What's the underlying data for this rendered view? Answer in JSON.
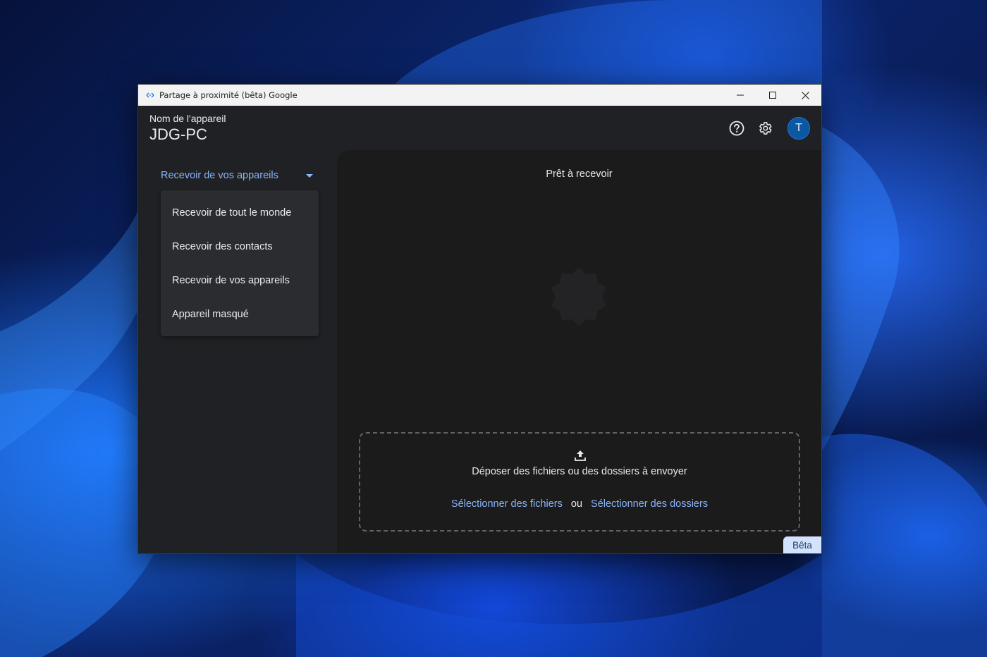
{
  "window": {
    "title": "Partage à proximité (bêta) Google",
    "minimize_glyph": "—",
    "maximize_glyph": "☐",
    "close_glyph": "✕"
  },
  "header": {
    "device_label": "Nom de l'appareil",
    "device_name": "JDG-PC",
    "help_icon": "help-circle-icon",
    "settings_icon": "gear-icon",
    "avatar_initial": "T"
  },
  "sidebar": {
    "selected_visibility": "Recevoir de vos appareils",
    "menu_items": [
      {
        "label": "Recevoir de tout le monde"
      },
      {
        "label": "Recevoir des contacts"
      },
      {
        "label": "Recevoir de vos appareils"
      },
      {
        "label": "Appareil masqué"
      }
    ]
  },
  "main": {
    "status": "Prêt à recevoir",
    "dropzone": {
      "icon": "upload-icon",
      "text": "Déposer des fichiers ou des dossiers à envoyer",
      "select_files": "Sélectionner des fichiers",
      "or": "ou",
      "select_folders": "Sélectionner des dossiers"
    }
  },
  "badge": "Bêta",
  "colors": {
    "accent": "#8ab4f8",
    "background": "#202124",
    "panel": "#1b1b1c",
    "avatar": "#0b57a0",
    "beta_badge": "#d3e3fd"
  }
}
